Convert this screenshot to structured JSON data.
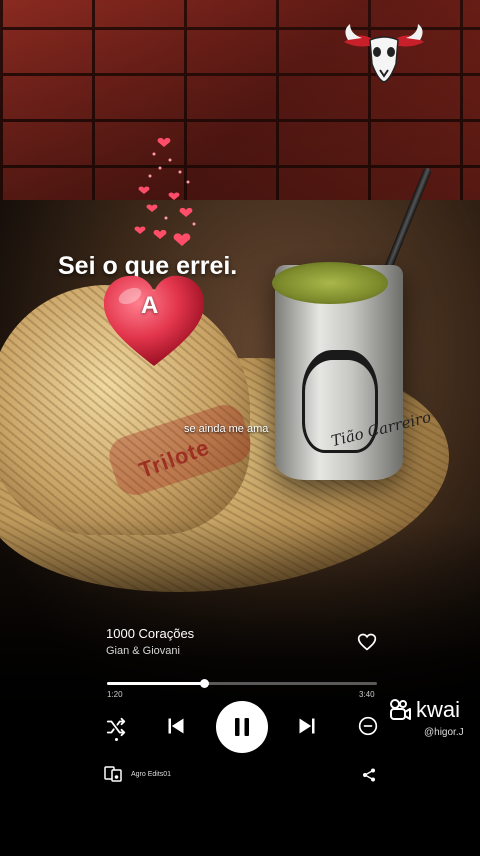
{
  "lyrics": {
    "main": "Sei o que errei.",
    "heart_letter": "A",
    "sub": "se ainda me ama"
  },
  "background": {
    "cup_signature": "Tião Carreiro",
    "hat_text": "Trilote"
  },
  "player": {
    "title": "1000 Corações",
    "artist": "Gian & Giovani",
    "elapsed": "1:20",
    "total": "3:40",
    "progress_fraction": 0.36,
    "device_label": "Agro Edits01",
    "is_playing": true
  },
  "watermark": {
    "brand": "kwai",
    "username": "@higor.J"
  },
  "colors": {
    "heart": "#e3364c",
    "accent": "#ffffff",
    "logo_red": "#c8202a"
  },
  "icons": {
    "logo": "bull-skull-logo-icon",
    "like": "heart-outline-icon",
    "shuffle": "shuffle-icon",
    "prev": "skip-previous-icon",
    "pause": "pause-icon",
    "next": "skip-next-icon",
    "minus": "remove-circle-icon",
    "device": "connect-device-icon",
    "share": "share-icon",
    "kwai": "kwai-logo-icon"
  }
}
